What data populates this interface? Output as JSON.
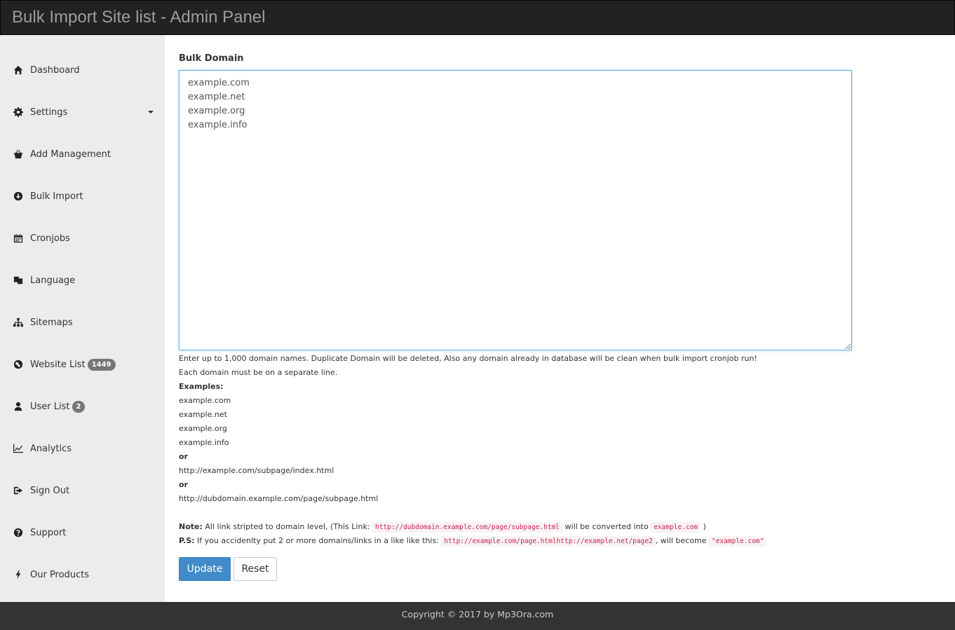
{
  "header": {
    "title": "Bulk Import Site list - Admin Panel"
  },
  "sidebar": {
    "items": [
      {
        "label": "Dashboard",
        "icon": "home-icon"
      },
      {
        "label": "Settings",
        "icon": "gear-icon"
      },
      {
        "label": "Add Management",
        "icon": "basket-icon"
      },
      {
        "label": "Bulk Import",
        "icon": "download-circle-icon"
      },
      {
        "label": "Cronjobs",
        "icon": "calendar-icon"
      },
      {
        "label": "Language",
        "icon": "language-icon"
      },
      {
        "label": "Sitemaps",
        "icon": "sitemap-icon"
      },
      {
        "label": "Website List",
        "icon": "globe-icon",
        "badge": "1449"
      },
      {
        "label": "User List",
        "icon": "user-icon",
        "badge": "2"
      },
      {
        "label": "Analytics",
        "icon": "line-chart-icon"
      },
      {
        "label": "Sign Out",
        "icon": "sign-out-icon"
      },
      {
        "label": "Support",
        "icon": "question-circle-icon"
      },
      {
        "label": "Our Products",
        "icon": "bolt-icon"
      }
    ]
  },
  "form": {
    "label": "Bulk Domain",
    "textarea_value": "example.com\nexample.net\nexample.org\nexample.info ",
    "help_line1": "Enter up to 1,000 domain names. Duplicate Domain will be deleted, Also any domain already in database will be clean when bulk import cronjob run!",
    "help_line2": "Each domain must be on a separate line.",
    "examples_label": "Examples:",
    "examples": [
      "example.com",
      "example.net",
      "example.org",
      "example.info"
    ],
    "or1": "or",
    "example_url1": "http://example.com/subpage/index.html",
    "or2": "or",
    "example_url2": "http://dubdomain.example.com/page/subpage.html",
    "note_label": "Note:",
    "note_text1": "All link stripted to domain level, (This Link:",
    "note_code1": "http://dubdomain.example.com/page/subpage.html",
    "note_text2": "will be converted into",
    "note_code2": "example.com",
    "note_text3": ")",
    "ps_label": "P.S:",
    "ps_text1": "If you accidenlty put 2 or more domains/links in a like like this:",
    "ps_code1": "http://example.com/page.htmlhttp://example.net/page2",
    "ps_text2": ", will become",
    "ps_code2": "\"example.com\"",
    "update_label": "Update",
    "reset_label": "Reset"
  },
  "footer": {
    "text": "Copyright © 2017 by Mp3Ora.com"
  }
}
